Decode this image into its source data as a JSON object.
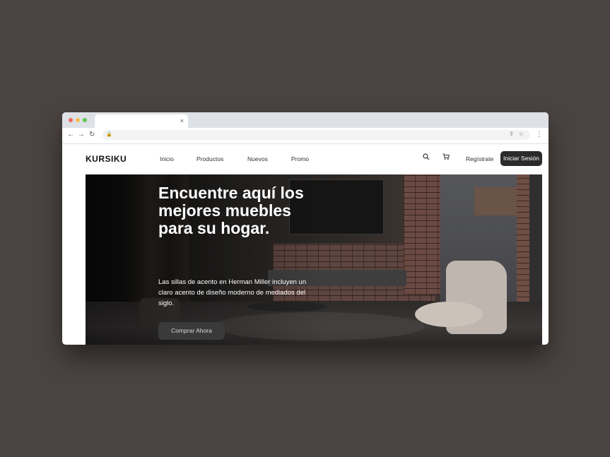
{
  "browser": {
    "icons": {
      "back": "arrow-left-icon",
      "forward": "arrow-right-icon",
      "reload": "reload-icon",
      "lock": "lock-icon",
      "share": "share-icon",
      "star": "star-icon",
      "menu": "kebab-menu-icon",
      "close": "close-icon"
    }
  },
  "site": {
    "brand": "KURSIKU",
    "nav": [
      "Inicio",
      "Productos",
      "Nuevos",
      "Promo"
    ],
    "icons": {
      "search": "search-icon",
      "cart": "cart-icon"
    },
    "register_label": "Regístrate",
    "login_label": "Iniciar Sesión"
  },
  "hero": {
    "title": "Encuentre aquí los mejores muebles para su hogar.",
    "description": "Las sillas de acento en Herman Miller incluyen un claro acento de diseño moderno de mediados del siglo.",
    "cta_label": "Comprar Ahora"
  },
  "colors": {
    "background": "#4a4341",
    "login_button": "#2b2b2b",
    "cta_button": "#3a3a3a"
  }
}
